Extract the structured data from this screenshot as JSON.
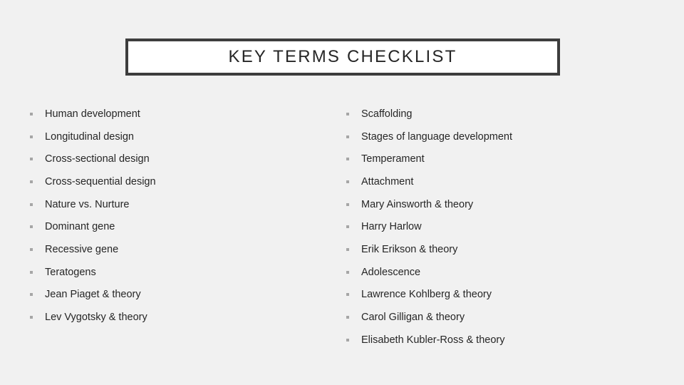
{
  "slide": {
    "background_color": "#f1f1f1",
    "title": {
      "text": "KEY TERMS CHECKLIST",
      "border_color": "#3d3d3d",
      "fill_color": "#ffffff",
      "text_color": "#262626"
    },
    "bullet_marker_color": "#a6a6a6",
    "body_text_color": "#262626",
    "columns": {
      "left": {
        "items": [
          {
            "label": "Human development"
          },
          {
            "label": "Longitudinal design"
          },
          {
            "label": "Cross-sectional design"
          },
          {
            "label": "Cross-sequential design"
          },
          {
            "label": "Nature vs. Nurture"
          },
          {
            "label": "Dominant gene"
          },
          {
            "label": "Recessive gene"
          },
          {
            "label": "Teratogens"
          },
          {
            "label": "Jean Piaget & theory"
          },
          {
            "label": "Lev Vygotsky & theory"
          }
        ]
      },
      "right": {
        "items": [
          {
            "label": "Scaffolding"
          },
          {
            "label": "Stages of language development"
          },
          {
            "label": "Temperament"
          },
          {
            "label": "Attachment"
          },
          {
            "label": "Mary Ainsworth & theory"
          },
          {
            "label": "Harry Harlow"
          },
          {
            "label": "Erik Erikson & theory"
          },
          {
            "label": "Adolescence"
          },
          {
            "label": "Lawrence Kohlberg & theory"
          },
          {
            "label": "Carol Gilligan & theory"
          },
          {
            "label": "Elisabeth Kubler-Ross & theory"
          }
        ]
      }
    }
  }
}
